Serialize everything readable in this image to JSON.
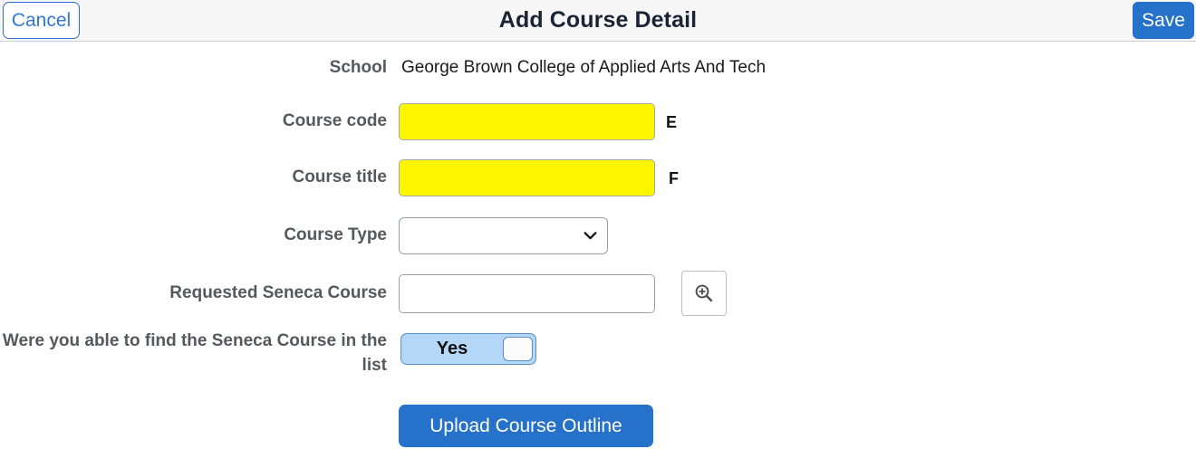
{
  "header": {
    "title": "Add Course Detail",
    "cancel_label": "Cancel",
    "save_label": "Save"
  },
  "form": {
    "school": {
      "label": "School",
      "value": "George Brown College of Applied Arts And Tech"
    },
    "course_code": {
      "label": "Course code",
      "value": "",
      "placeholder": "",
      "annotation": "E",
      "field_color": "#fbf500"
    },
    "course_title": {
      "label": "Course title",
      "value": "",
      "placeholder": "",
      "annotation": "F",
      "field_color": "#fbf500"
    },
    "course_type": {
      "label": "Course Type",
      "selected": "",
      "options": [
        ""
      ]
    },
    "requested_seneca_course": {
      "label": "Requested Seneca Course",
      "value": "",
      "placeholder": "",
      "lookup_icon": "search-zoom-in-icon"
    },
    "found_course_toggle": {
      "label": "Were you able to find the Seneca Course in the list",
      "state_label": "Yes"
    },
    "upload_button": {
      "label": "Upload Course Outline"
    }
  },
  "colors": {
    "accent_blue": "#2671c9",
    "header_bg": "#f7f7f8",
    "highlight_yellow": "#fbf500",
    "toggle_on": "#b4d6f7"
  }
}
